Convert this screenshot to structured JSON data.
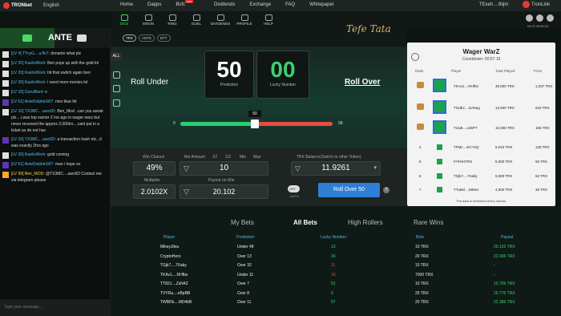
{
  "topbar": {
    "brand": "TRONbet",
    "lang": "English",
    "nav": [
      "Home",
      "Dapps",
      "Bcfc",
      "Dividends",
      "Exchange",
      "FAQ",
      "Whitepaper"
    ],
    "new_badge": "new",
    "user": "TExeh....9iijm",
    "tronlink": "TronLink"
  },
  "subnav": [
    "DICE",
    "MOON",
    "RING",
    "DUEL",
    "DIVIDENDS",
    "PROFILE",
    "HELP"
  ],
  "tetetet_logo": "Tefe Tata",
  "mute_label": "MUTE WINDOW",
  "chat": {
    "title": "ANTE",
    "placeholder": "Type your message...",
    "messages": [
      {
        "name": "[LV 4] TYvyG....uJfv7:",
        "text": " donante what plz",
        "av": "a"
      },
      {
        "name": "[LV 20] KashxWork:",
        "text": " Ben pops up with the gold lol",
        "av": "a"
      },
      {
        "name": "[LV 20] KashxWork:",
        "text": " hit that switch again ben",
        "av": "a"
      },
      {
        "name": "[LV 20] KashxWork:",
        "text": " i need more monies lol",
        "av": "a"
      },
      {
        "name": "[LV 15] GuruBlunt:",
        "text": " n",
        "av": "a"
      },
      {
        "name": "[LV 61] AnteDolphin007:",
        "text": " nice blue hit",
        "av": "c"
      },
      {
        "name": "[LV 10] TX3MC....awc6D:",
        "text": " Ben_Mod ..can you assist plz....i was top earner 2 hrs ago in wager warz but never received the approx 2,000trx....cant put in a ticket as do not hav",
        "av": "a"
      },
      {
        "name": "[LV 10] TX3MC....awc6D:",
        "text": " a transaction hash etc...it was exactly 2hrs ago",
        "av": "c"
      },
      {
        "name": "[LV 20] KashxWork:",
        "text": " gold coming",
        "av": "a"
      },
      {
        "name": "[LV 61] AnteDolphin007:",
        "text": " man i hope so",
        "av": "c"
      },
      {
        "name": "[LV 99] Ben_MOD:",
        "text": " @TX3MC....awc6D Contact me via telegram please",
        "av": "d",
        "yellow": true
      }
    ]
  },
  "game": {
    "tabs": [
      "TRX",
      "ANTE",
      "BTT"
    ],
    "all": "ALL",
    "roll_under": "Roll Under",
    "roll_over": "Roll Over",
    "prediction": "50",
    "prediction_label": "Prediction",
    "lucky": "00",
    "lucky_label": "Lucky Number",
    "slider_min": "0",
    "slider_max": "99",
    "slider_value": "50",
    "slider_fraction": 0.5
  },
  "controls": {
    "win_chance_label": "Win Chance",
    "win_chance": "49%",
    "bet_label": "Bet Amount",
    "x2": "X2",
    "half": "1/2",
    "min": "Min",
    "max": "Max",
    "bet": "10",
    "balance_label": "TRX Balance(Switch to other Token)",
    "balance": "11.9261",
    "mult_label": "Multiplier",
    "mult": "2.0102X",
    "payout_label": "Payout on Win",
    "payout": "20.102",
    "toggle": "OFF",
    "auto": "AUTO",
    "roll_btn": "Roll Over 50"
  },
  "wager": {
    "title": "Wager WarZ",
    "countdown": "Countdown: 00:57:19",
    "headers": [
      "Rank",
      "Player",
      "Total Played",
      "Prize"
    ],
    "rows": [
      {
        "rank": "",
        "player": "TKAv1....RHfbs",
        "played": "49,000 TRX",
        "prize": "1,037 TRX"
      },
      {
        "rank": "",
        "player": "TGdEz....DAbeg",
        "played": "12,600 TRX",
        "prize": "519 TRX"
      },
      {
        "rank": "",
        "player": "TUuB....x45PT",
        "played": "10,000 TRX",
        "prize": "155 TRX"
      },
      {
        "rank": "4",
        "player": "TFMz....ECYsQ",
        "played": "5,010 TRX",
        "prize": "130 TRX"
      },
      {
        "rank": "5",
        "player": "FATHHTRX",
        "played": "5,000 TRX",
        "prize": "65 TRX"
      },
      {
        "rank": "6",
        "player": "TGjk7....7Xaky",
        "played": "5,000 TRX",
        "prize": "52 TRX"
      },
      {
        "rank": "7",
        "player": "TTuBvl....MMnJ",
        "played": "4,500 TRX",
        "prize": "39 TRX"
      }
    ],
    "note": "The data is refreshed every minute."
  },
  "bets": {
    "tabs": [
      "My Bets",
      "All Bets",
      "High Rollers",
      "Rare Wins"
    ],
    "headers": [
      "Player",
      "Prediction",
      "Lucky Number",
      "Bets",
      "Payout"
    ],
    "rows": [
      {
        "player": "MikeyJitsu",
        "pred": "Under 49",
        "lucky": "13",
        "lc": "g",
        "bet": "10 TRX",
        "payout": "20.102 TRX",
        "pc": "g"
      },
      {
        "player": "CryptoHero",
        "pred": "Over 13",
        "lucky": "34",
        "lc": "g",
        "bet": "20 TRX",
        "payout": "22.906 TRX",
        "pc": "g"
      },
      {
        "player": "TGjk7....7Xaky",
        "pred": "Over 32",
        "lucky": "11",
        "lc": "r",
        "bet": "10 TRX",
        "payout": "-",
        "pc": "w"
      },
      {
        "player": "TKAv1....RHfbs",
        "pred": "Under 11",
        "lucky": "16",
        "lc": "r",
        "bet": "7000 TRX",
        "payout": "-",
        "pc": "w"
      },
      {
        "player": "TT82J....ZsN4Z",
        "pred": "Over 7",
        "lucky": "91",
        "lc": "g",
        "bet": "10 TRX",
        "payout": "10.706 TRX",
        "pc": "g"
      },
      {
        "player": "TVYRa....eBpBB",
        "pred": "Over 8",
        "lucky": "9",
        "lc": "g",
        "bet": "25 TRX",
        "payout": "26.776 TRX",
        "pc": "g"
      },
      {
        "player": "TWBRk....MD4kB",
        "pred": "Over 11",
        "lucky": "97",
        "lc": "g",
        "bet": "20 TRX",
        "payout": "22.386 TRX",
        "pc": "g"
      }
    ]
  }
}
